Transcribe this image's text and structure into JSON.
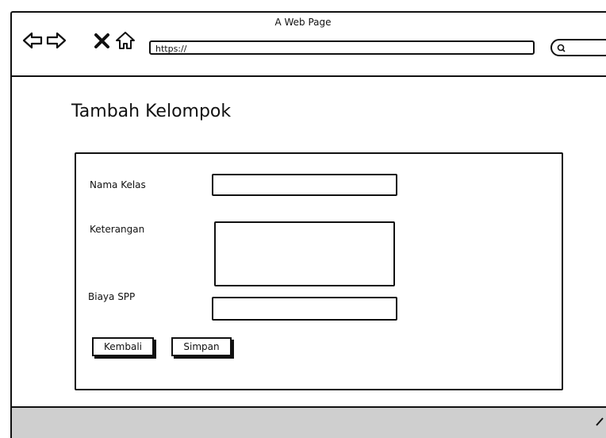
{
  "browser": {
    "title": "A Web Page",
    "url": "https://",
    "icons": [
      "back-arrow-icon",
      "forward-arrow-icon",
      "close-x-icon",
      "home-icon",
      "search-icon"
    ]
  },
  "page": {
    "title": "Tambah Kelompok"
  },
  "form": {
    "nama_kelas_label": "Nama Kelas",
    "keterangan_label": "Keterangan",
    "biaya_spp_label": "Biaya SPP",
    "nama_kelas_value": "",
    "keterangan_value": "",
    "biaya_spp_value": ""
  },
  "buttons": {
    "kembali": "Kembali",
    "simpan": "Simpan"
  }
}
